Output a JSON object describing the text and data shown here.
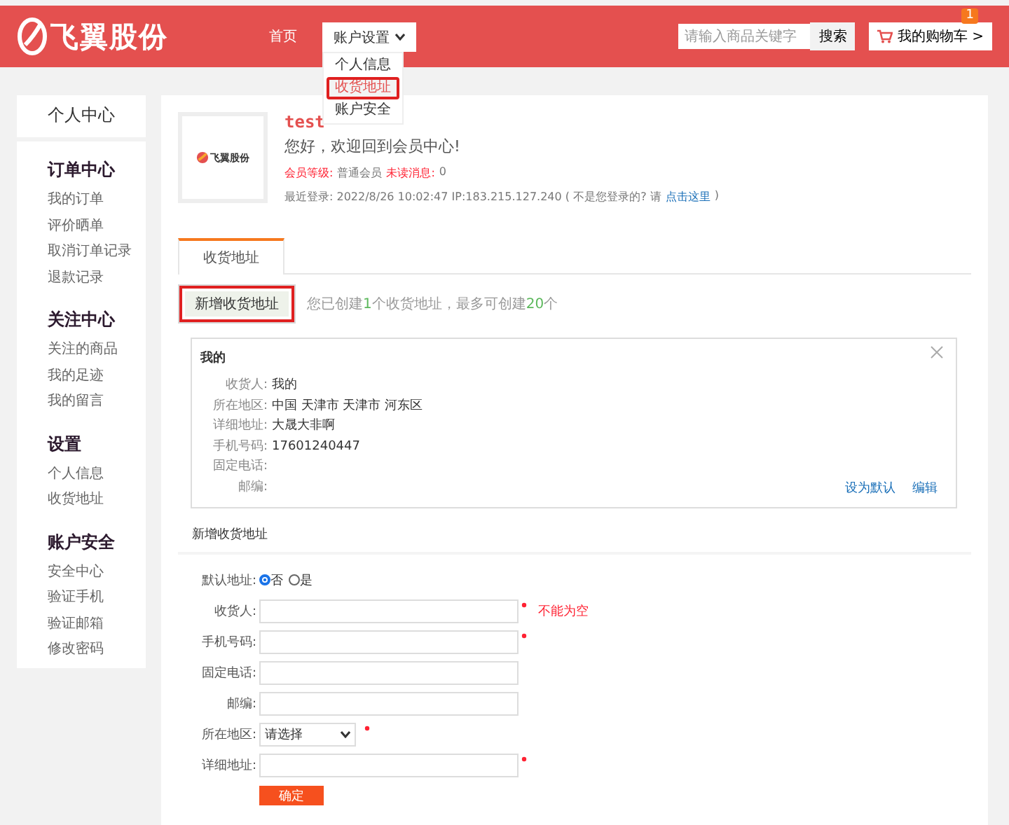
{
  "header": {
    "logo_text": "飞翼股份",
    "nav": [
      {
        "label": "首页",
        "kind": "link"
      },
      {
        "label": "账户设置",
        "kind": "dropdown",
        "expanded": true
      }
    ],
    "dropdown_items": [
      {
        "label": "个人信息",
        "highlighted": false
      },
      {
        "label": "收货地址",
        "highlighted": true
      },
      {
        "label": "账户安全",
        "highlighted": false
      }
    ],
    "search": {
      "placeholder": "请输入商品关键字",
      "button": "搜索"
    },
    "cart": {
      "label": "我的购物车 >",
      "badge": "1"
    }
  },
  "sidebar": {
    "title": "个人中心",
    "groups": [
      {
        "title": "订单中心",
        "items": [
          "我的订单",
          "评价晒单",
          "取消订单记录",
          "退款记录"
        ]
      },
      {
        "title": "关注中心",
        "items": [
          "关注的商品",
          "我的足迹",
          "我的留言"
        ]
      },
      {
        "title": "设置",
        "items": [
          "个人信息",
          "收货地址"
        ]
      },
      {
        "title": "账户安全",
        "items": [
          "安全中心",
          "验证手机",
          "验证邮箱",
          "修改密码"
        ]
      }
    ]
  },
  "profile": {
    "logo_text": "飞翼股份",
    "username": "test",
    "welcome": "您好，欢迎回到会员中心!",
    "level_label": "会员等级:",
    "level_value": "普通会员",
    "unread_label": "未读消息:",
    "unread_value": "0",
    "last_login": "最近登录: 2022/8/26 10:02:47 IP:183.215.127.240 ( 不是您登录的? 请",
    "login_link": "点击这里",
    "last_login_end": ")"
  },
  "tabs": [
    {
      "label": "收货地址",
      "selected": true
    }
  ],
  "add_button": {
    "label": "新增收货地址",
    "highlighted": true
  },
  "note": {
    "prefix": "您已创建",
    "count": "1",
    "middle": "个收货地址，最多可创建",
    "max": "20",
    "suffix": "个"
  },
  "address_card": {
    "title": "我的",
    "fields": [
      {
        "label": "收货人:",
        "value": "我的"
      },
      {
        "label": "所在地区:",
        "value": "中国 天津市 天津市 河东区"
      },
      {
        "label": "详细地址:",
        "value": "大晟大非啊"
      },
      {
        "label": "手机号码:",
        "value": "17601240447"
      },
      {
        "label": "固定电话:"
      },
      {
        "label": "邮编:"
      }
    ],
    "actions": [
      "设为默认",
      "编辑"
    ]
  },
  "form": {
    "title": "新增收货地址",
    "default": {
      "label": "默认地址:",
      "options": [
        {
          "label": "否",
          "selected": true
        },
        {
          "label": "是",
          "selected": false
        }
      ]
    },
    "fields": [
      {
        "label": "收货人:",
        "kind": "text",
        "required": true,
        "error": "不能为空"
      },
      {
        "label": "手机号码:",
        "kind": "text",
        "required": true
      },
      {
        "label": "固定电话:",
        "kind": "text",
        "required": false
      },
      {
        "label": "邮编:",
        "kind": "text",
        "required": false
      },
      {
        "label": "所在地区:",
        "kind": "select",
        "required": true,
        "value": "请选择"
      },
      {
        "label": "详细地址:",
        "kind": "text",
        "required": true
      }
    ],
    "submit": "确定"
  }
}
